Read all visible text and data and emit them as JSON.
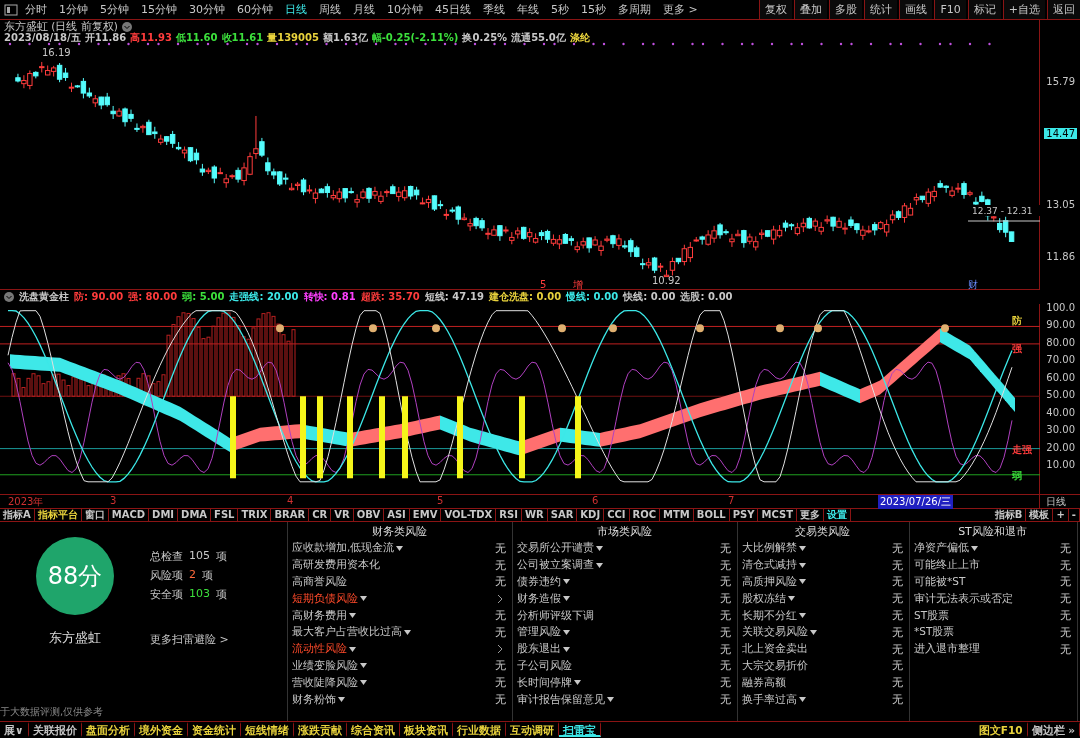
{
  "toolbar": {
    "periods": [
      {
        "label": "分时",
        "selected": false
      },
      {
        "label": "1分钟",
        "selected": false
      },
      {
        "label": "5分钟",
        "selected": false
      },
      {
        "label": "15分钟",
        "selected": false
      },
      {
        "label": "30分钟",
        "selected": false
      },
      {
        "label": "60分钟",
        "selected": false
      },
      {
        "label": "日线",
        "selected": true
      },
      {
        "label": "周线",
        "selected": false
      },
      {
        "label": "月线",
        "selected": false
      },
      {
        "label": "10分钟",
        "selected": false
      },
      {
        "label": "45日线",
        "selected": false
      },
      {
        "label": "季线",
        "selected": false
      },
      {
        "label": "年线",
        "selected": false
      },
      {
        "label": "5秒",
        "selected": false
      },
      {
        "label": "15秒",
        "selected": false
      },
      {
        "label": "多周期",
        "selected": false
      },
      {
        "label": "更多 >",
        "selected": false
      }
    ],
    "actions": [
      "复权",
      "叠加",
      "多股",
      "统计",
      "画线",
      "F10",
      "标记",
      "+自选",
      "返回"
    ]
  },
  "quote": {
    "title": "东方盛虹 (日线 前复权)",
    "fields": [
      {
        "text": "2023/08/18/五",
        "color": "#c8c8c8"
      },
      {
        "text": "开11.86",
        "color": "#c8c8c8"
      },
      {
        "text": "高11.93",
        "color": "#ff3c3c"
      },
      {
        "text": "低11.60",
        "color": "#3ce03c"
      },
      {
        "text": "收11.61",
        "color": "#3ce03c"
      },
      {
        "text": "量139005",
        "color": "#e8d23c"
      },
      {
        "text": "额1.63亿",
        "color": "#c8c8c8"
      },
      {
        "text": "幅-0.25(-2.11%)",
        "color": "#3ce03c"
      },
      {
        "text": "换0.25%",
        "color": "#c8c8c8"
      },
      {
        "text": "流通55.0亿",
        "color": "#c8c8c8"
      },
      {
        "text": "涤纶",
        "color": "#e8d23c"
      }
    ]
  },
  "price_axis": [
    {
      "label": "15.79",
      "highlighted": false
    },
    {
      "label": "14.47",
      "highlighted": true
    },
    {
      "label": "13.05",
      "highlighted": false
    },
    {
      "label": "11.86",
      "highlighted": false
    }
  ],
  "chart_marks": {
    "high_label": "16.19",
    "low_label": "10.92",
    "range_label": "12.37 - 12.31",
    "events": [
      "5",
      "增",
      "财"
    ]
  },
  "indicator": {
    "name": "洗盘黄金柱",
    "params": [
      {
        "text": "防: 90.00",
        "color": "#ff3c3c"
      },
      {
        "text": "强: 80.00",
        "color": "#ff3c3c"
      },
      {
        "text": "弱: 5.00",
        "color": "#3ce03c"
      },
      {
        "text": "走强线: 20.00",
        "color": "#3ce8e8"
      },
      {
        "text": "转快: 0.81",
        "color": "#ff40ff"
      },
      {
        "text": "超跌: 35.70",
        "color": "#ff3c3c"
      },
      {
        "text": "短线: 47.19",
        "color": "#c8c8c8"
      },
      {
        "text": "建仓洗盘: 0.00",
        "color": "#e8d23c"
      },
      {
        "text": "慢线: 0.00",
        "color": "#3ce8e8"
      },
      {
        "text": "快线: 0.00",
        "color": "#c8c8c8"
      },
      {
        "text": "选股: 0.00",
        "color": "#c8c8c8"
      }
    ],
    "axis": [
      "100.0",
      "90.00",
      "80.00",
      "70.00",
      "60.00",
      "50.00",
      "40.00",
      "30.00",
      "20.00",
      "10.00"
    ],
    "line_labels": [
      {
        "text": "防",
        "color": "#e8d23c"
      },
      {
        "text": "强",
        "color": "#ff3c3c"
      },
      {
        "text": "走强",
        "color": "#ff3c3c"
      },
      {
        "text": "弱",
        "color": "#3ce03c"
      }
    ]
  },
  "date_axis": {
    "labels": [
      "2023年",
      "3",
      "4",
      "5",
      "6",
      "7"
    ],
    "cursor": "2023/07/26/三",
    "period": "日线"
  },
  "indicator_tabs": {
    "left": [
      {
        "label": "指标A",
        "color": "#c8c8c8"
      },
      {
        "label": "指标平台",
        "color": "#e8d23c"
      },
      {
        "label": "窗口",
        "color": "#c8c8c8"
      },
      {
        "label": "MACD",
        "color": "#c8c8c8"
      },
      {
        "label": "DMI",
        "color": "#c8c8c8"
      },
      {
        "label": "DMA",
        "color": "#c8c8c8"
      },
      {
        "label": "FSL",
        "color": "#c8c8c8"
      },
      {
        "label": "TRIX",
        "color": "#c8c8c8"
      },
      {
        "label": "BRAR",
        "color": "#c8c8c8"
      },
      {
        "label": "CR",
        "color": "#c8c8c8"
      },
      {
        "label": "VR",
        "color": "#c8c8c8"
      },
      {
        "label": "OBV",
        "color": "#c8c8c8"
      },
      {
        "label": "ASI",
        "color": "#c8c8c8"
      },
      {
        "label": "EMV",
        "color": "#c8c8c8"
      },
      {
        "label": "VOL-TDX",
        "color": "#c8c8c8"
      },
      {
        "label": "RSI",
        "color": "#c8c8c8"
      },
      {
        "label": "WR",
        "color": "#c8c8c8"
      },
      {
        "label": "SAR",
        "color": "#c8c8c8"
      },
      {
        "label": "KDJ",
        "color": "#c8c8c8"
      },
      {
        "label": "CCI",
        "color": "#c8c8c8"
      },
      {
        "label": "ROC",
        "color": "#c8c8c8"
      },
      {
        "label": "MTM",
        "color": "#c8c8c8"
      },
      {
        "label": "BOLL",
        "color": "#c8c8c8"
      },
      {
        "label": "PSY",
        "color": "#c8c8c8"
      },
      {
        "label": "MCST",
        "color": "#c8c8c8"
      },
      {
        "label": "更多",
        "color": "#c8c8c8"
      },
      {
        "label": "设置",
        "color": "#3ce8e8"
      }
    ],
    "right": [
      "指标B",
      "模板",
      "+",
      "-"
    ]
  },
  "scan": {
    "score": "88分",
    "stock": "东方盛虹",
    "stats": [
      {
        "label": "总检查",
        "count": "105",
        "unit": "项",
        "color": "#c8c8c8"
      },
      {
        "label": "风险项",
        "count": "2",
        "unit": "项",
        "color": "#ff6a3c"
      },
      {
        "label": "安全项",
        "count": "103",
        "unit": "项",
        "color": "#3ce03c"
      }
    ],
    "more_link": "更多扫雷避险 >",
    "disclaimer": "于大数据评测,仅供参考",
    "columns": [
      {
        "title": "财务类风险",
        "items": [
          {
            "label": "应收款增加,低现金流",
            "menu": true,
            "risk": false,
            "value": "无"
          },
          {
            "label": "高研发费用资本化",
            "menu": false,
            "risk": false,
            "value": "无"
          },
          {
            "label": "高商誉风险",
            "menu": false,
            "risk": false,
            "value": "无"
          },
          {
            "label": "短期负债风险",
            "menu": true,
            "risk": true
          },
          {
            "label": "高财务费用",
            "menu": true,
            "risk": false,
            "value": "无"
          },
          {
            "label": "最大客户占营收比过高",
            "menu": true,
            "risk": false,
            "value": "无"
          },
          {
            "label": "流动性风险",
            "menu": true,
            "risk": true
          },
          {
            "label": "业绩变脸风险",
            "menu": true,
            "risk": false,
            "value": "无"
          },
          {
            "label": "营收陡降风险",
            "menu": true,
            "risk": false,
            "value": "无"
          },
          {
            "label": "财务粉饰",
            "menu": true,
            "risk": false,
            "value": "无"
          }
        ]
      },
      {
        "title": "市场类风险",
        "items": [
          {
            "label": "交易所公开谴责",
            "menu": true,
            "risk": false,
            "value": "无"
          },
          {
            "label": "公司被立案调查",
            "menu": true,
            "risk": false,
            "value": "无"
          },
          {
            "label": "债券违约",
            "menu": true,
            "risk": false,
            "value": "无"
          },
          {
            "label": "财务造假",
            "menu": true,
            "risk": false,
            "value": "无"
          },
          {
            "label": "分析师评级下调",
            "menu": false,
            "risk": false,
            "value": "无"
          },
          {
            "label": "管理风险",
            "menu": true,
            "risk": false,
            "value": "无"
          },
          {
            "label": "股东退出",
            "menu": true,
            "risk": false,
            "value": "无"
          },
          {
            "label": "子公司风险",
            "menu": false,
            "risk": false,
            "value": "无"
          },
          {
            "label": "长时间停牌",
            "menu": true,
            "risk": false,
            "value": "无"
          },
          {
            "label": "审计报告保留意见",
            "menu": true,
            "risk": false,
            "value": "无"
          }
        ]
      },
      {
        "title": "交易类风险",
        "items": [
          {
            "label": "大比例解禁",
            "menu": true,
            "risk": false,
            "value": "无"
          },
          {
            "label": "清仓式减持",
            "menu": true,
            "risk": false,
            "value": "无"
          },
          {
            "label": "高质押风险",
            "menu": true,
            "risk": false,
            "value": "无"
          },
          {
            "label": "股权冻结",
            "menu": true,
            "risk": false,
            "value": "无"
          },
          {
            "label": "长期不分红",
            "menu": true,
            "risk": false,
            "value": "无"
          },
          {
            "label": "关联交易风险",
            "menu": true,
            "risk": false,
            "value": "无"
          },
          {
            "label": "北上资金卖出",
            "menu": false,
            "risk": false,
            "value": "无"
          },
          {
            "label": "大宗交易折价",
            "menu": false,
            "risk": false,
            "value": "无"
          },
          {
            "label": "融券高额",
            "menu": false,
            "risk": false,
            "value": "无"
          },
          {
            "label": "换手率过高",
            "menu": true,
            "risk": false,
            "value": "无"
          }
        ]
      },
      {
        "title": "ST风险和退市",
        "items": [
          {
            "label": "净资产偏低",
            "menu": true,
            "risk": false,
            "value": "无"
          },
          {
            "label": "可能终止上市",
            "menu": false,
            "risk": false,
            "value": "无"
          },
          {
            "label": "可能被*ST",
            "menu": false,
            "risk": false,
            "value": "无"
          },
          {
            "label": "审计无法表示或否定",
            "menu": false,
            "risk": false,
            "value": "无"
          },
          {
            "label": "ST股票",
            "menu": false,
            "risk": false,
            "value": "无"
          },
          {
            "label": "*ST股票",
            "menu": false,
            "risk": false,
            "value": "无"
          },
          {
            "label": "进入退市整理",
            "menu": false,
            "risk": false,
            "value": "无"
          }
        ]
      }
    ]
  },
  "status_bar": {
    "tabs": [
      {
        "label": "展∨",
        "color": "#c8c8c8",
        "selected": false
      },
      {
        "label": "关联报价",
        "color": "#c8c8c8",
        "selected": false
      },
      {
        "label": "盘面分析",
        "color": "#e8d23c",
        "selected": false
      },
      {
        "label": "境外资金",
        "color": "#e8d23c",
        "selected": false
      },
      {
        "label": "资金统计",
        "color": "#e8d23c",
        "selected": false
      },
      {
        "label": "短线情绪",
        "color": "#e8d23c",
        "selected": false
      },
      {
        "label": "涨跌贡献",
        "color": "#e8d23c",
        "selected": false
      },
      {
        "label": "综合资讯",
        "color": "#e8d23c",
        "selected": false
      },
      {
        "label": "板块资讯",
        "color": "#e8d23c",
        "selected": false
      },
      {
        "label": "行业数据",
        "color": "#e8d23c",
        "selected": false
      },
      {
        "label": "互动调研",
        "color": "#e8d23c",
        "selected": false
      },
      {
        "label": "扫雷宝",
        "color": "#3ce8e8",
        "selected": true
      }
    ],
    "right": [
      "图文F10",
      "侧边栏 »"
    ]
  }
}
